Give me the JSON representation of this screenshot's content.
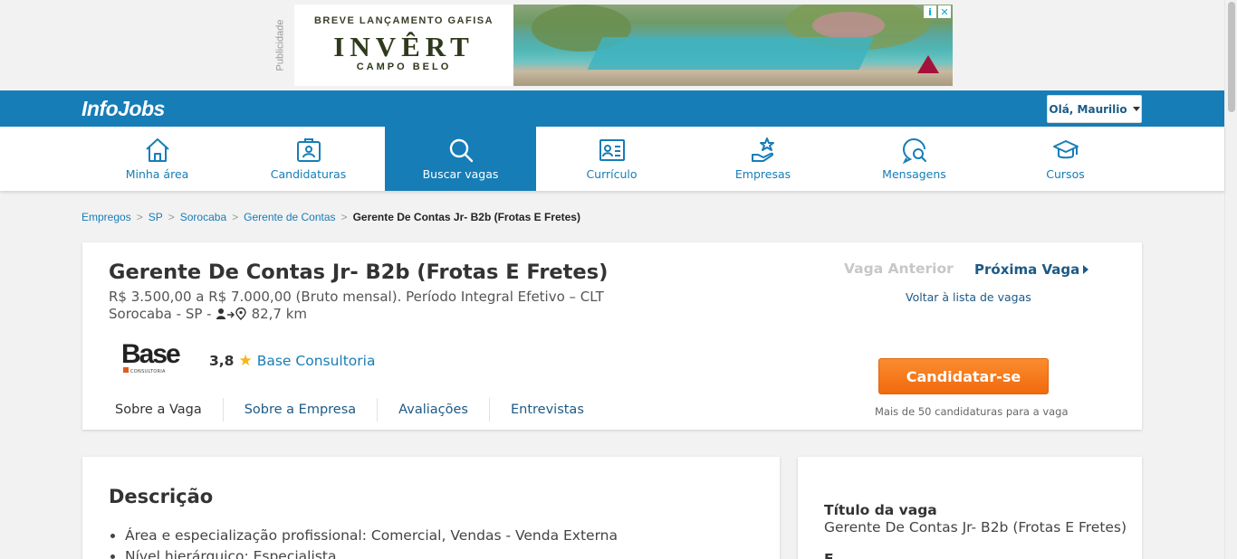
{
  "ad": {
    "label": "Publicidade",
    "line1": "BREVE LANÇAMENTO GAFISA",
    "line2": "INVÊRT",
    "line3": "CAMPO BELO"
  },
  "header": {
    "logo": "InfoJobs",
    "user_greeting": "Olá, Maurilio"
  },
  "nav": {
    "items": [
      {
        "label": "Minha área",
        "icon": "home-icon"
      },
      {
        "label": "Candidaturas",
        "icon": "clipboard-icon"
      },
      {
        "label": "Buscar vagas",
        "icon": "search-icon",
        "active": true
      },
      {
        "label": "Currículo",
        "icon": "id-card-icon"
      },
      {
        "label": "Empresas",
        "icon": "hand-star-icon"
      },
      {
        "label": "Mensagens",
        "icon": "chat-search-icon"
      },
      {
        "label": "Cursos",
        "icon": "graduation-cap-icon"
      }
    ]
  },
  "breadcrumb": {
    "items": [
      "Empregos",
      "SP",
      "Sorocaba",
      "Gerente de Contas"
    ],
    "current": "Gerente De Contas Jr- B2b (Frotas E Fretes)"
  },
  "job": {
    "title": "Gerente De Contas Jr- B2b (Frotas E Fretes)",
    "salary": "R$ 3.500,00 a R$ 7.000,00 (Bruto mensal). Período Integral Efetivo – CLT",
    "location": "Sorocaba - SP -",
    "distance": "82,7 km",
    "company_rating": "3,8",
    "company_name": "Base Consultoria",
    "company_logo_text": "Base",
    "company_logo_sub": "CONSULTORIA",
    "prev_label": "Vaga Anterior",
    "next_label": "Próxima Vaga",
    "back_label": "Voltar à lista de vagas",
    "apply_label": "Candidatar-se",
    "apply_note": "Mais de 50 candidaturas para a vaga",
    "tabs": [
      "Sobre a Vaga",
      "Sobre a Empresa",
      "Avaliações",
      "Entrevistas"
    ]
  },
  "description": {
    "title": "Descrição",
    "items": [
      "Área e especialização profissional: Comercial, Vendas - Venda Externa",
      "Nível hierárquico: Especialista"
    ]
  },
  "sidebar": {
    "title_label": "Título da vaga",
    "title_value": "Gerente De Contas Jr- B2b (Frotas E Fretes)",
    "next_label": "E"
  },
  "colors": {
    "brand_blue": "#167db7",
    "link_blue": "#1c5a86",
    "apply_orange": "#f47a1f",
    "star": "#f5b51b"
  }
}
